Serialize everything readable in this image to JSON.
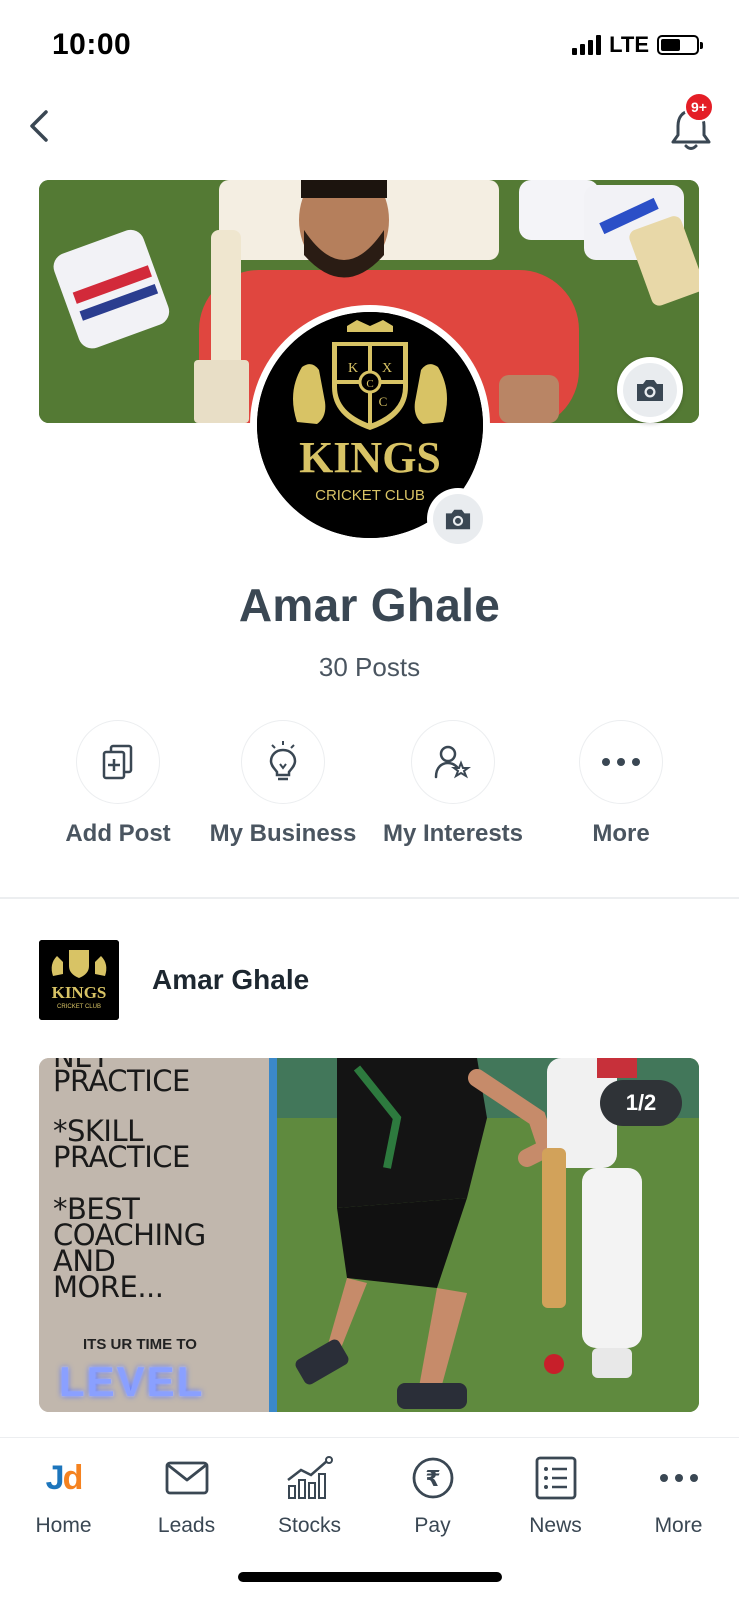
{
  "status_bar": {
    "time": "10:00",
    "network": "LTE",
    "battery_level": 0.55
  },
  "header": {
    "notification_badge": "9+"
  },
  "profile": {
    "name": "Amar Ghale",
    "posts_count": "30 Posts",
    "logo_text": "KINGS",
    "logo_subtext": "CRICKET CLUB",
    "crest_letters": [
      "K",
      "X",
      "C",
      "C"
    ]
  },
  "actions": [
    {
      "label": "Add Post",
      "icon": "add-post-icon"
    },
    {
      "label": "My Business",
      "icon": "lightbulb-icon"
    },
    {
      "label": "My Interests",
      "icon": "interests-icon"
    },
    {
      "label": "More",
      "icon": "more-dots-icon"
    }
  ],
  "post": {
    "author": "Amar Ghale",
    "counter": "1/2",
    "media_lines": [
      "NET",
      "PRACTICE",
      "*SKILL",
      "PRACTICE",
      "*BEST",
      "COACHING",
      "AND",
      "MORE..."
    ],
    "media_small": "ITS UR TIME TO",
    "media_level": "LEVEL"
  },
  "bottom_nav": [
    {
      "label": "Home",
      "icon": "jd-logo-icon",
      "logo_j": "J",
      "logo_d": "d"
    },
    {
      "label": "Leads",
      "icon": "envelope-icon"
    },
    {
      "label": "Stocks",
      "icon": "stocks-chart-icon"
    },
    {
      "label": "Pay",
      "icon": "rupee-icon",
      "symbol": "₹"
    },
    {
      "label": "News",
      "icon": "news-list-icon"
    },
    {
      "label": "More",
      "icon": "more-dots-icon"
    }
  ],
  "colors": {
    "accent_red": "#e41e26",
    "jd_blue": "#1c75bc",
    "jd_orange": "#f5821f",
    "text_primary": "#3a4753"
  }
}
